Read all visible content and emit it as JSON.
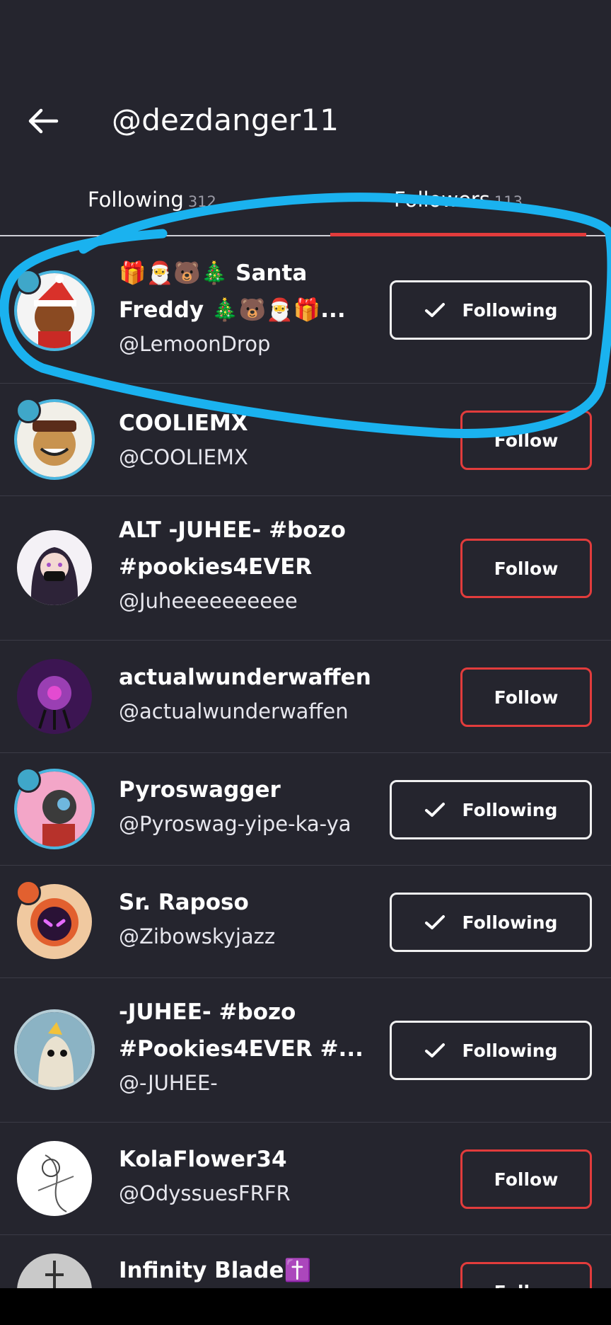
{
  "header": {
    "title": "@dezdanger11"
  },
  "tabs": [
    {
      "label": "Following",
      "count": "312"
    },
    {
      "label": "Followers",
      "count": "113"
    }
  ],
  "users": [
    {
      "name": "🎁🎅🐻🎄 Santa Freddy 🎄🐻🎅🎁...",
      "handle": "@LemoonDrop",
      "button": "Following"
    },
    {
      "name": "COOLIEMX",
      "handle": "@COOLIEMX",
      "button": "Follow"
    },
    {
      "name": "ALT -JUHEE- #bozo #pookies4EVER",
      "handle": "@Juheeeeeeeeee",
      "button": "Follow"
    },
    {
      "name": "actualwunderwaffen",
      "handle": "@actualwunderwaffen",
      "button": "Follow"
    },
    {
      "name": "Pyroswagger",
      "handle": "@Pyroswag-yipe-ka-ya",
      "button": "Following"
    },
    {
      "name": "Sr. Raposo",
      "handle": "@Zibowskyjazz",
      "button": "Following"
    },
    {
      "name": "-JUHEE- #bozo #Pookies4EVER #...",
      "handle": "@-JUHEE-",
      "button": "Following"
    },
    {
      "name": "KolaFlower34",
      "handle": "@OdyssuesFRFR",
      "button": "Follow"
    },
    {
      "name": "Infinity Blade✝️",
      "handle": "",
      "button": "Follow"
    }
  ],
  "colors": {
    "background": "#25252e",
    "accent": "#e23c3c",
    "annotation": "#1ab2ef"
  },
  "icons": {
    "back": "arrow-left-icon",
    "check": "check-icon"
  }
}
